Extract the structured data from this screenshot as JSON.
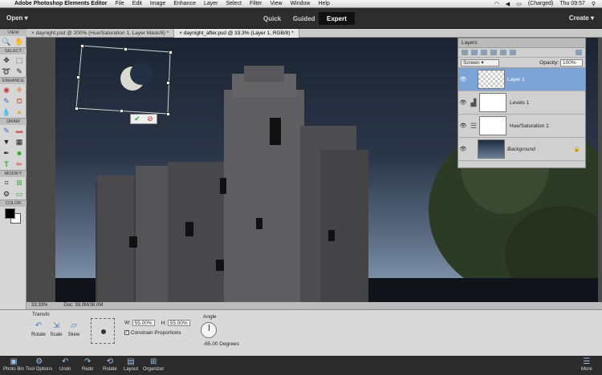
{
  "menubar": {
    "app_name": "Adobe Photoshop Elements Editor",
    "items": [
      "File",
      "Edit",
      "Image",
      "Enhance",
      "Layer",
      "Select",
      "Filter",
      "View",
      "Window",
      "Help"
    ],
    "battery": "(Charged)",
    "clock": "Thu 09:57"
  },
  "header": {
    "open_label": "Open",
    "create_label": "Create",
    "modes": [
      "Quick",
      "Guided",
      "Expert"
    ],
    "active_mode": "Expert"
  },
  "toolbox": {
    "sections": [
      "VIEW",
      "SELECT",
      "ENHANCE",
      "DRAW",
      "MODIFY",
      "COLOR"
    ]
  },
  "tabs": [
    {
      "label": "daynight.psd @ 200% (Hue/Saturation 1, Layer Mask/8) *",
      "active": false
    },
    {
      "label": "daynight_after.psd @ 33.3% (Layer 1, RGB/8) *",
      "active": true
    }
  ],
  "layers_panel": {
    "title": "Layers",
    "blend_mode": "Screen",
    "opacity_label": "Opacity:",
    "opacity_value": "100%",
    "layers": [
      {
        "name": "Layer 1",
        "selected": true
      },
      {
        "name": "Levels 1",
        "selected": false
      },
      {
        "name": "Hue/Saturation 1",
        "selected": false
      },
      {
        "name": "Background",
        "selected": false
      }
    ]
  },
  "status": {
    "zoom": "33.33%",
    "doc": "Doc: 38.0M/38.0M"
  },
  "tool_options": {
    "title": "Transfo",
    "buttons": [
      "Rotate",
      "Scale",
      "Skew"
    ],
    "w_label": "W:",
    "w_value": "55.00%",
    "h_label": "H:",
    "h_value": "55.00%",
    "constrain_label": "Constrain Proportions",
    "angle_label": "Angle",
    "angle_value": "-85.00",
    "angle_unit": "Degrees"
  },
  "taskbar": {
    "buttons": [
      "Photo Bin",
      "Tool Options",
      "Undo",
      "Redo",
      "Rotate",
      "Layout",
      "Organizer"
    ],
    "more_label": "More"
  },
  "colors": {
    "header_bg": "#2d2d2d",
    "selected_layer": "#7da4d6",
    "accent_blue": "#3e79c0"
  }
}
